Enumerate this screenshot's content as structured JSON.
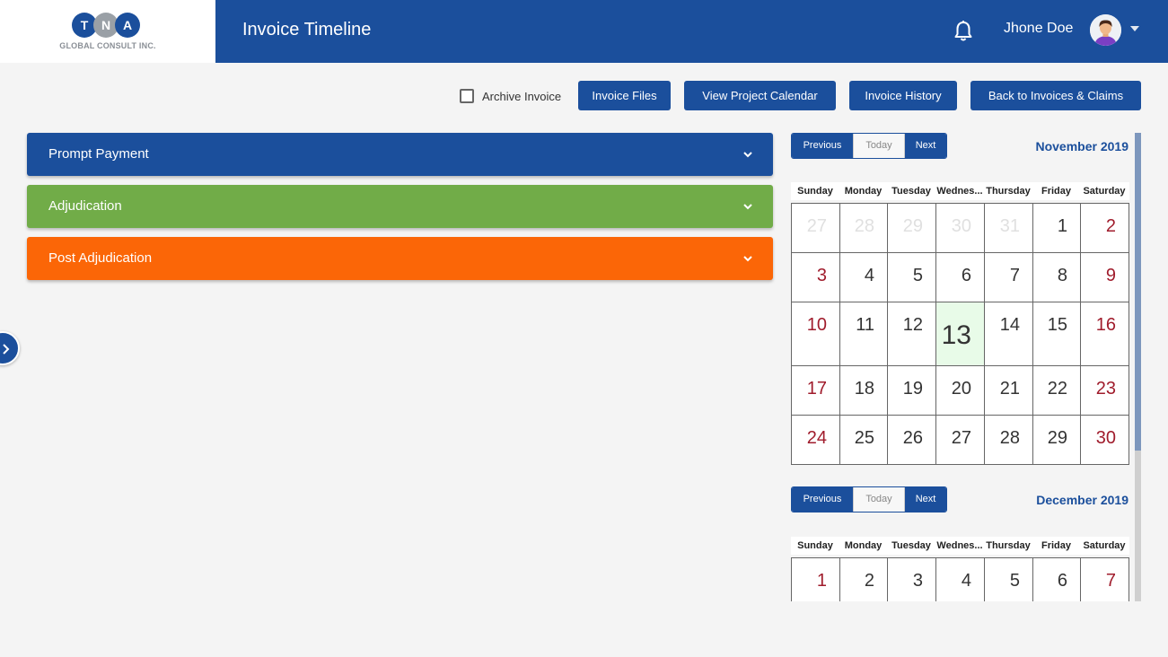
{
  "header": {
    "logo_letters": [
      "T",
      "N",
      "A"
    ],
    "logo_text": "GLOBAL CONSULT INC.",
    "title": "Invoice Timeline",
    "bell_icon": "bell-icon",
    "user_name": "Jhone Doe",
    "brand_color": "#1b4f9c"
  },
  "toolbar": {
    "archive_label": "Archive Invoice",
    "archive_checked": false,
    "buttons": [
      "Invoice Files",
      "View Project Calendar",
      "Invoice History",
      "Back to Invoices & Claims"
    ]
  },
  "accordions": [
    {
      "label": "Prompt Payment",
      "color": "#1b4f9c"
    },
    {
      "label": "Adjudication",
      "color": "#71ac48"
    },
    {
      "label": "Post Adjudication",
      "color": "#fb6607"
    }
  ],
  "calendar": {
    "nav": {
      "prev": "Previous",
      "today": "Today",
      "next": "Next"
    },
    "weekdays": [
      "Sunday",
      "Monday",
      "Tuesday",
      "Wednes...",
      "Thursday",
      "Friday",
      "Saturday"
    ],
    "months": [
      {
        "title": "November 2019",
        "today": "13",
        "weeks": [
          [
            "27",
            "28",
            "29",
            "30",
            "31",
            "1",
            "2"
          ],
          [
            "3",
            "4",
            "5",
            "6",
            "7",
            "8",
            "9"
          ],
          [
            "10",
            "11",
            "12",
            "13",
            "14",
            "15",
            "16"
          ],
          [
            "17",
            "18",
            "19",
            "20",
            "21",
            "22",
            "23"
          ],
          [
            "24",
            "25",
            "26",
            "27",
            "28",
            "29",
            "30"
          ]
        ]
      },
      {
        "title": "December 2019",
        "weeks": [
          [
            "1",
            "2",
            "3",
            "4",
            "5",
            "6",
            "7"
          ]
        ]
      }
    ]
  }
}
